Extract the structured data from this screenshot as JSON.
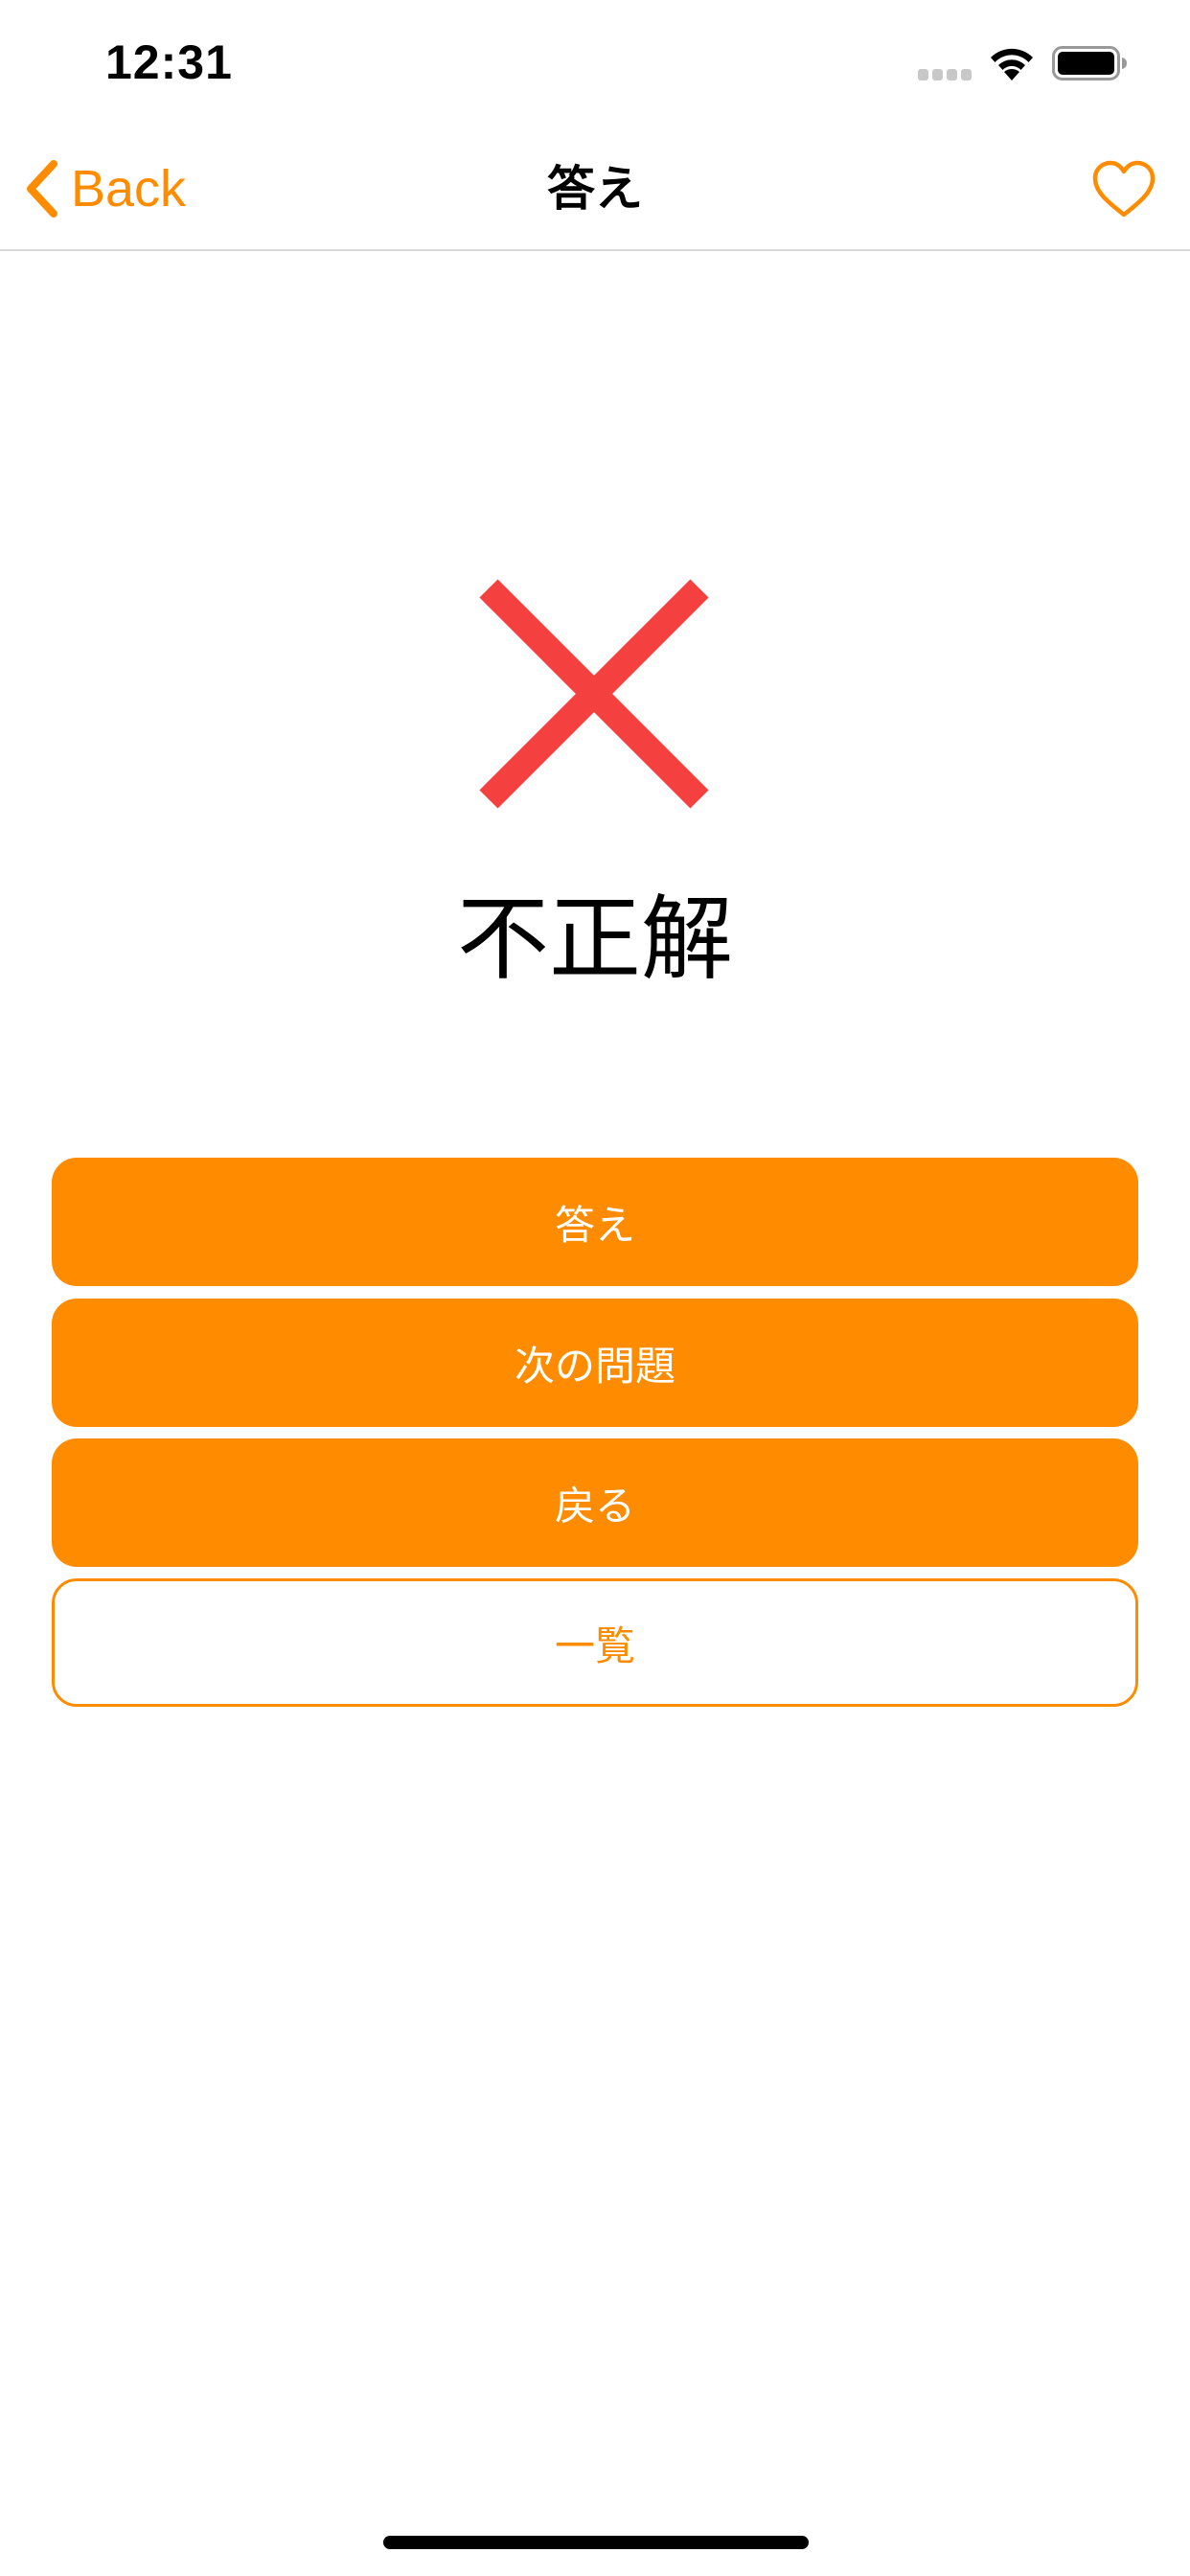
{
  "status_bar": {
    "time": "12:31",
    "icons": [
      "signal-icon",
      "wifi-icon",
      "battery-icon"
    ]
  },
  "nav": {
    "back_label": "Back",
    "title": "答え",
    "back_icon": "chevron-left-icon",
    "favorite_icon": "heart-outline-icon"
  },
  "result": {
    "mark_icon": "cross-icon",
    "text": "不正解"
  },
  "buttons": {
    "answer": "答え",
    "next_question": "次の問題",
    "back": "戻る",
    "list": "一覧"
  },
  "colors": {
    "accent": "#ff8c00",
    "incorrect_mark": "#f4403f",
    "text": "#000000",
    "background": "#ffffff"
  }
}
